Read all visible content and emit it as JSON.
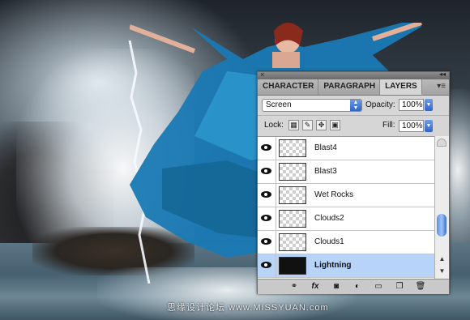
{
  "watermark": "思缘设计论坛 www.MISSYUAN.com",
  "panel": {
    "tabs": [
      "CHARACTER",
      "PARAGRAPH",
      "LAYERS"
    ],
    "active_tab": "LAYERS",
    "blend_mode": "Screen",
    "opacity_label": "Opacity:",
    "opacity_value": "100%",
    "lock_label": "Lock:",
    "fill_label": "Fill:",
    "fill_value": "100%",
    "menu_icon": "panel-menu-icon",
    "layers": [
      {
        "name": "Blast4",
        "visible": true,
        "thumb": "transparent"
      },
      {
        "name": "Blast3",
        "visible": true,
        "thumb": "transparent"
      },
      {
        "name": "Wet Rocks",
        "visible": true,
        "thumb": "transparent"
      },
      {
        "name": "Clouds2",
        "visible": true,
        "thumb": "transparent"
      },
      {
        "name": "Clouds1",
        "visible": true,
        "thumb": "transparent"
      },
      {
        "name": "Lightning",
        "visible": true,
        "thumb": "dark",
        "selected": true
      }
    ],
    "bottom_tools": {
      "link": "link-layers-icon",
      "fx": "fx",
      "mask": "add-mask-icon",
      "adjustment": "adjustment-layer-icon",
      "group": "new-group-icon",
      "new_layer": "new-layer-icon",
      "trash": "delete-layer-icon"
    },
    "selection_color": "#b7d3f9",
    "accent_color": "#2f63c7"
  }
}
